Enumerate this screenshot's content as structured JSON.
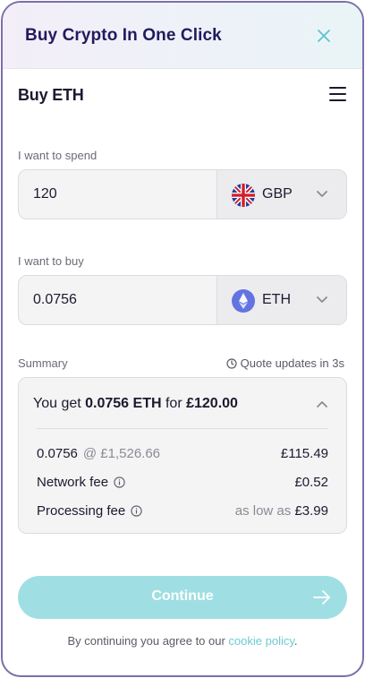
{
  "window": {
    "title": "Buy Crypto In One Click",
    "close_icon": "close-icon"
  },
  "header": {
    "title": "Buy ETH",
    "menu_icon": "hamburger-menu-icon"
  },
  "spend": {
    "label": "I want to spend",
    "amount": "120",
    "currency": "GBP",
    "currency_icon": "uk-flag-icon"
  },
  "buy": {
    "label": "I want to buy",
    "amount": "0.0756",
    "currency": "ETH",
    "currency_icon": "ethereum-icon"
  },
  "summary": {
    "label": "Summary",
    "quote_updates": "Quote updates in 3s",
    "head_prefix": "You get ",
    "head_amount": "0.0756 ETH",
    "head_for": " for ",
    "head_price": "£120.00",
    "rate_amount": "0.0756",
    "rate_at": "@ £1,526.66",
    "rate_total": "£115.49",
    "network_fee_label": "Network fee",
    "network_fee_value": "£0.52",
    "processing_fee_label": "Processing fee",
    "processing_fee_prefix": "as low as ",
    "processing_fee_value": "£3.99"
  },
  "continue": {
    "label": "Continue"
  },
  "terms": {
    "text": "By continuing you agree to our ",
    "link": "cookie policy",
    "suffix": "."
  },
  "colors": {
    "accent": "#9fdfe3",
    "title": "#231a5e",
    "link": "#6ccbd2",
    "frame_border": "#7a70a8"
  }
}
